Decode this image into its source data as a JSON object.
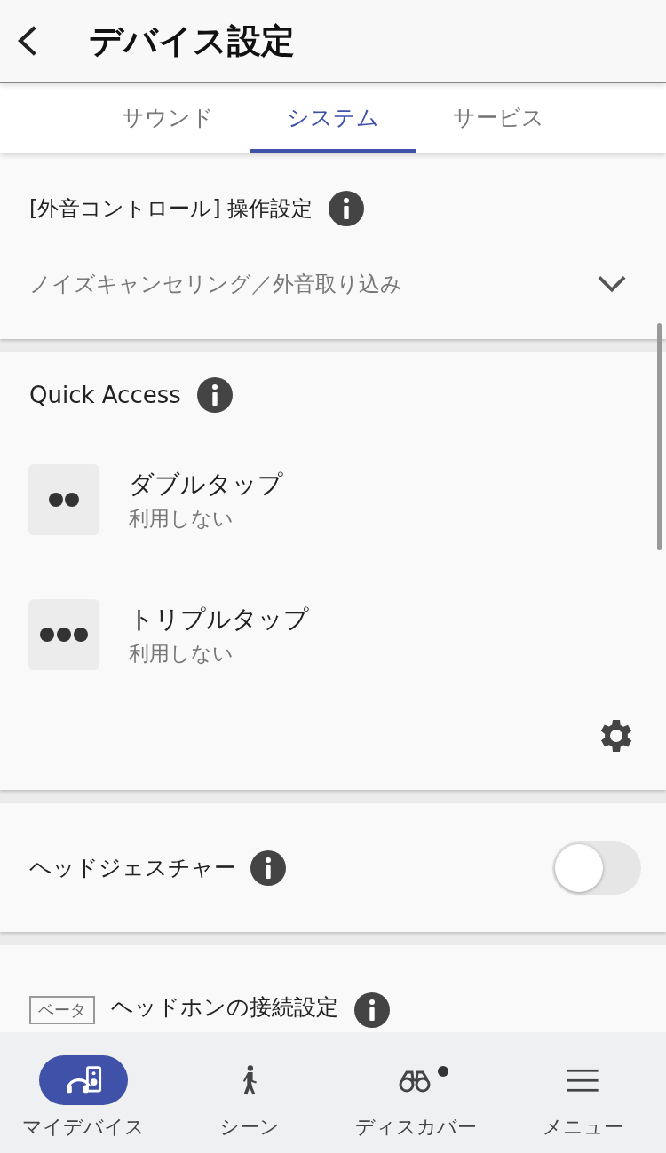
{
  "header": {
    "title": "デバイス設定"
  },
  "tabs": [
    {
      "label": "サウンド",
      "selected": false
    },
    {
      "label": "システム",
      "selected": true
    },
    {
      "label": "サービス",
      "selected": false
    }
  ],
  "ambient_control": {
    "title": "[外音コントロール] 操作設定",
    "value": "ノイズキャンセリング／外音取り込み"
  },
  "quick_access": {
    "title": "Quick Access",
    "items": [
      {
        "kind": "double",
        "label": "ダブルタップ",
        "value": "利用しない"
      },
      {
        "kind": "triple",
        "label": "トリプルタップ",
        "value": "利用しない"
      }
    ]
  },
  "head_gesture": {
    "label": "ヘッドジェスチャー",
    "on": false
  },
  "connection": {
    "badge": "ベータ",
    "label": "ヘッドホンの接続設定"
  },
  "bottom_nav": [
    {
      "label": "マイデバイス",
      "kind": "devices",
      "selected": true,
      "badge": false
    },
    {
      "label": "シーン",
      "kind": "scene",
      "selected": false,
      "badge": false
    },
    {
      "label": "ディスカバー",
      "kind": "discover",
      "selected": false,
      "badge": true
    },
    {
      "label": "メニュー",
      "kind": "menu",
      "selected": false,
      "badge": false
    }
  ]
}
